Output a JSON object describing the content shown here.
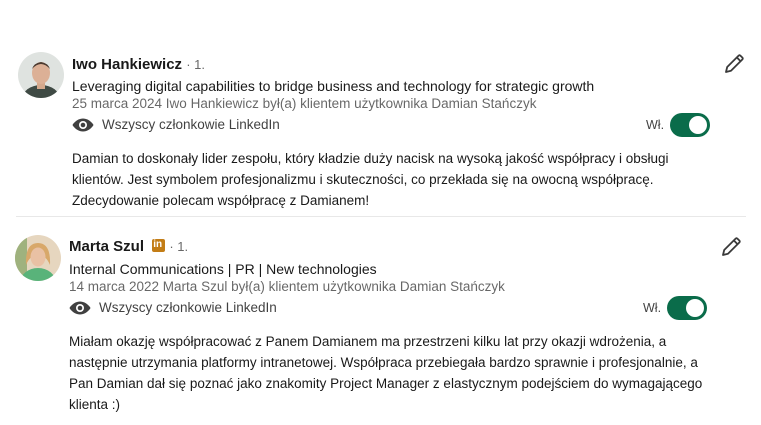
{
  "recommendations": [
    {
      "name": "Iwo Hankiewicz",
      "degree": "· 1.",
      "headline": "Leveraging digital capabilities to bridge business and technology for strategic growth",
      "meta": "25 marca 2024 Iwo Hankiewicz był(a) klientem użytkownika Damian Stańczyk",
      "visibility": "Wszyscy członkowie LinkedIn",
      "toggle_label": "Wł.",
      "toggle_on": true,
      "text": "Damian to doskonały lider zespołu, który kładzie duży nacisk na wysoką jakość współpracy i obsługi klientów. Jest symbolem profesjonalizmu i skuteczności, co przekłada się na owocną współpracę. Zdecydowanie polecam współpracę z Damianem!"
    },
    {
      "name": "Marta Szul",
      "degree": "· 1.",
      "headline": "Internal Communications | PR | New technologies",
      "meta": "14 marca 2022 Marta Szul był(a) klientem użytkownika Damian Stańczyk",
      "visibility": "Wszyscy członkowie LinkedIn",
      "toggle_label": "Wł.",
      "toggle_on": true,
      "text": "Miałam okazję współpracować z Panem Damianem ma przestrzeni kilku lat przy okazji wdrożenia, a następnie utrzymania platformy intranetowej. Współpraca przebiegała bardzo sprawnie i profesjonalnie, a Pan Damian dał się poznać jako znakomity Project Manager z elastycznym podejściem do wymagającego klienta :)"
    }
  ],
  "icons": {
    "visibility": "eye-icon",
    "edit": "pencil-icon",
    "badge": "linkedin-premium-badge-icon"
  },
  "colors": {
    "toggle_on": "#0a6c4a",
    "badge": "#c37d16"
  }
}
